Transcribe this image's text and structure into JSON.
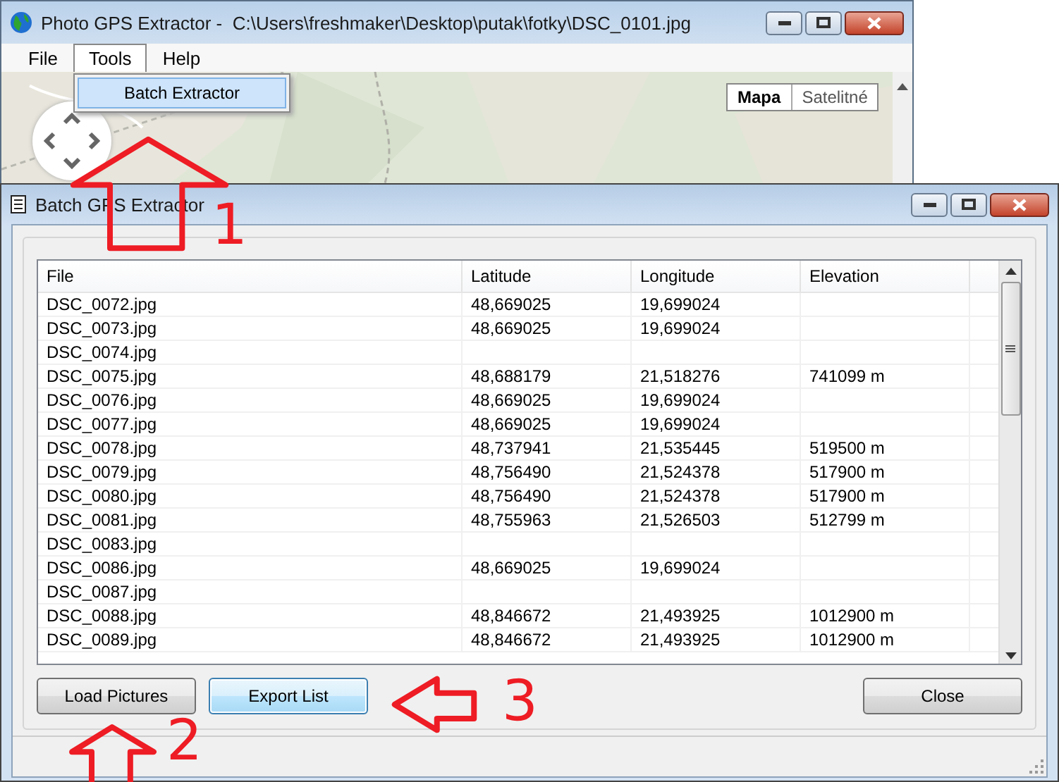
{
  "main_window": {
    "title": "Photo GPS Extractor -  C:\\Users\\freshmaker\\Desktop\\putak\\fotky\\DSC_0101.jpg",
    "menu": [
      {
        "label": "File",
        "selected": false
      },
      {
        "label": "Tools",
        "selected": true
      },
      {
        "label": "Help",
        "selected": false
      }
    ],
    "open_menu": [
      {
        "label": "Batch Extractor",
        "selected": true
      }
    ],
    "map": {
      "kind": "picture",
      "map_types": [
        {
          "label": "Mapa",
          "selected": true
        },
        {
          "label": "Satelitné",
          "selected": false
        }
      ]
    }
  },
  "dialog": {
    "title": "Batch GPS Extractor",
    "table": {
      "columns": [
        "File",
        "Latitude",
        "Longitude",
        "Elevation"
      ],
      "rows": [
        {
          "file": "DSC_0072.jpg",
          "latitude": "48,669025",
          "longitude": "19,699024"
        },
        {
          "file": "DSC_0073.jpg",
          "latitude": "48,669025",
          "longitude": "19,699024"
        },
        {
          "file": "DSC_0074.jpg"
        },
        {
          "file": "DSC_0075.jpg",
          "latitude": "48,688179",
          "longitude": "21,518276",
          "elevation": "741099 m"
        },
        {
          "file": "DSC_0076.jpg",
          "latitude": "48,669025",
          "longitude": "19,699024"
        },
        {
          "file": "DSC_0077.jpg",
          "latitude": "48,669025",
          "longitude": "19,699024"
        },
        {
          "file": "DSC_0078.jpg",
          "latitude": "48,737941",
          "longitude": "21,535445",
          "elevation": "519500 m"
        },
        {
          "file": "DSC_0079.jpg",
          "latitude": "48,756490",
          "longitude": "21,524378",
          "elevation": "517900 m"
        },
        {
          "file": "DSC_0080.jpg",
          "latitude": "48,756490",
          "longitude": "21,524378",
          "elevation": "517900 m"
        },
        {
          "file": "DSC_0081.jpg",
          "latitude": "48,755963",
          "longitude": "21,526503",
          "elevation": "512799 m"
        },
        {
          "file": "DSC_0083.jpg"
        },
        {
          "file": "DSC_0086.jpg",
          "latitude": "48,669025",
          "longitude": "19,699024"
        },
        {
          "file": "DSC_0087.jpg"
        },
        {
          "file": "DSC_0088.jpg",
          "latitude": "48,846672",
          "longitude": "21,493925",
          "elevation": "1012900 m"
        },
        {
          "file": "DSC_0089.jpg",
          "latitude": "48,846672",
          "longitude": "21,493925",
          "elevation": "1012900 m"
        }
      ]
    },
    "buttons": [
      {
        "label": "Load Pictures",
        "focused": false
      },
      {
        "label": "Export List",
        "focused": true
      },
      {
        "label": "Close",
        "focused": false
      }
    ]
  },
  "annotations": [
    {
      "kind": "up-arrow",
      "label": "1"
    },
    {
      "kind": "up-arrow",
      "label": "2"
    },
    {
      "kind": "left-arrow",
      "label": "3"
    }
  ]
}
